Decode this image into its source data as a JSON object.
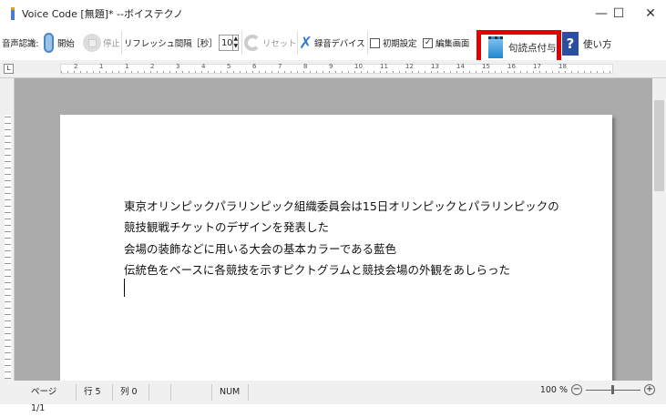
{
  "window": {
    "title": "Voice Code [無題]* --ボイステクノ",
    "minimize": "—",
    "maximize": "☐",
    "close": "✕"
  },
  "toolbar": {
    "speech_label": "音声認識:",
    "start": "開始",
    "stop": "停止",
    "refresh_label": "リフレッシュ間隔［秒］",
    "refresh_value": "10",
    "reset": "リセット",
    "device": "録音デバイス",
    "init_settings": "初期設定",
    "init_checked": false,
    "edit_screen": "編集画面",
    "edit_checked": true,
    "punctuation": "句読点付与",
    "help": "使い方"
  },
  "ruler": {
    "corner": "L",
    "labels": [
      "2",
      "1",
      "1",
      "2",
      "3",
      "4",
      "5",
      "6",
      "7",
      "8",
      "9",
      "10",
      "11",
      "12",
      "13",
      "14",
      "15",
      "16",
      "17",
      "18"
    ]
  },
  "document": {
    "lines": [
      "東京オリンピックパラリンピック組織委員会は15日オリンピックとパラリンピックの",
      "競技観戦チケットのデザインを発表した",
      "会場の装飾などに用いる大会の基本カラーである藍色",
      "伝統色をベースに各競技を示すピクトグラムと競技会場の外観をあしらった"
    ]
  },
  "status": {
    "page": "ページ 1/1",
    "row": "行 5",
    "col": "列 0",
    "num": "NUM",
    "zoom": "100 %",
    "zoom_out": "−",
    "zoom_in": "+"
  },
  "colors": {
    "highlight": "#e30000",
    "canvas": "#ababab"
  }
}
